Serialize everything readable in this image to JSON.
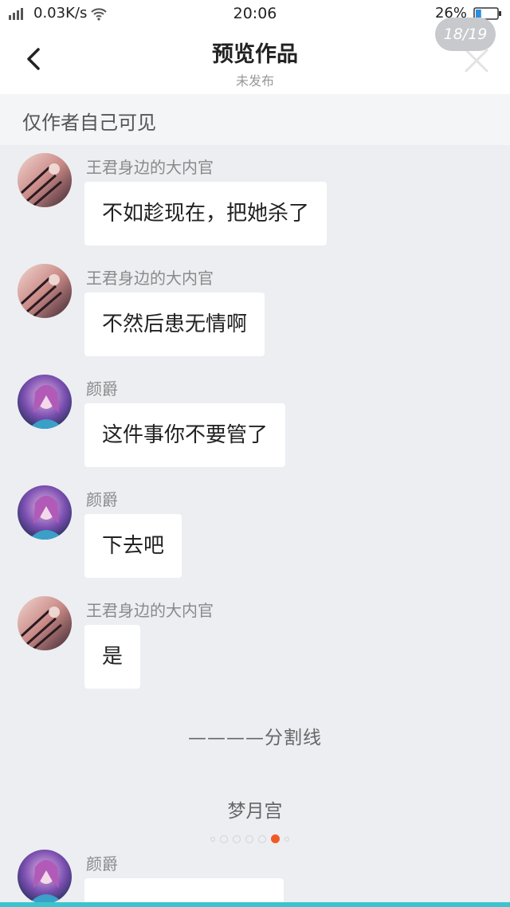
{
  "status_bar": {
    "network_speed": "0.03K/s",
    "time": "20:06",
    "battery_percent": "26%",
    "battery_level": 0.26
  },
  "header": {
    "title": "预览作品",
    "subtitle": "未发布",
    "back_icon": "chevron-left-icon",
    "close_icon": "close-icon"
  },
  "visibility": {
    "text": "仅作者自己可见",
    "page_counter": "18/19"
  },
  "messages": [
    {
      "name": "王君身边的大内官",
      "text": "不如趁现在，把她杀了",
      "avatar": "avatar-eunuch"
    },
    {
      "name": "王君身边的大内官",
      "text": "不然后患无情啊",
      "avatar": "avatar-eunuch"
    },
    {
      "name": "颜爵",
      "text": "这件事你不要管了",
      "avatar": "avatar-yanjue"
    },
    {
      "name": "颜爵",
      "text": "下去吧",
      "avatar": "avatar-yanjue"
    },
    {
      "name": "王君身边的大内官",
      "text": "是",
      "avatar": "avatar-eunuch"
    },
    {
      "name": "颜爵",
      "text": "",
      "avatar": "avatar-yanjue"
    }
  ],
  "divider": "————分割线",
  "location": "梦月宫",
  "pager": {
    "total": 7,
    "active_index": 5
  },
  "colors": {
    "accent": "#f15a24",
    "background": "#eceef2",
    "bottom_line": "#3cc3cf"
  }
}
